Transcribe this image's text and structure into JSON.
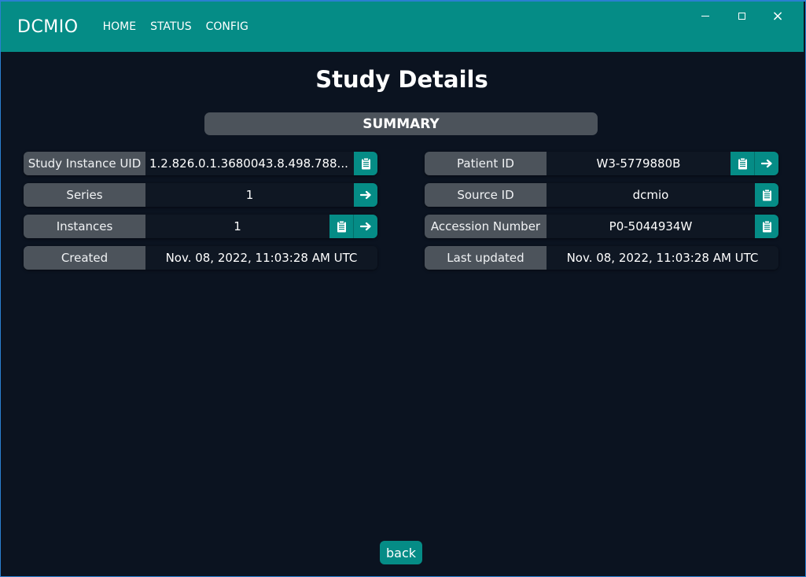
{
  "app": {
    "name": "DCMIO"
  },
  "nav": [
    {
      "label": "HOME"
    },
    {
      "label": "STATUS"
    },
    {
      "label": "CONFIG"
    }
  ],
  "window_controls": {
    "minimize": "minimize-icon",
    "maximize": "maximize-icon",
    "close": "×"
  },
  "page": {
    "title": "Study Details",
    "section": "SUMMARY",
    "back_label": "back"
  },
  "left_fields": [
    {
      "label": "Study Instance UID",
      "value": "1.2.826.0.1.3680043.8.498.788...",
      "copy": true,
      "open": false
    },
    {
      "label": "Series",
      "value": "1",
      "copy": false,
      "open": true
    },
    {
      "label": "Instances",
      "value": "1",
      "copy": true,
      "open": true
    },
    {
      "label": "Created",
      "value": "Nov. 08, 2022, 11:03:28 AM UTC",
      "copy": false,
      "open": false
    }
  ],
  "right_fields": [
    {
      "label": "Patient ID",
      "value": "W3-5779880B",
      "copy": true,
      "open": true
    },
    {
      "label": "Source ID",
      "value": "dcmio",
      "copy": true,
      "open": false
    },
    {
      "label": "Accession Number",
      "value": "P0-5044934W",
      "copy": true,
      "open": false
    },
    {
      "label": "Last updated",
      "value": "Nov. 08, 2022, 11:03:28 AM UTC",
      "copy": false,
      "open": false
    }
  ],
  "colors": {
    "accent": "#058c86",
    "background": "#0b1320",
    "label_bg": "#4c535b"
  },
  "icons": {
    "copy": "clipboard-icon",
    "open": "arrow-right-icon"
  }
}
